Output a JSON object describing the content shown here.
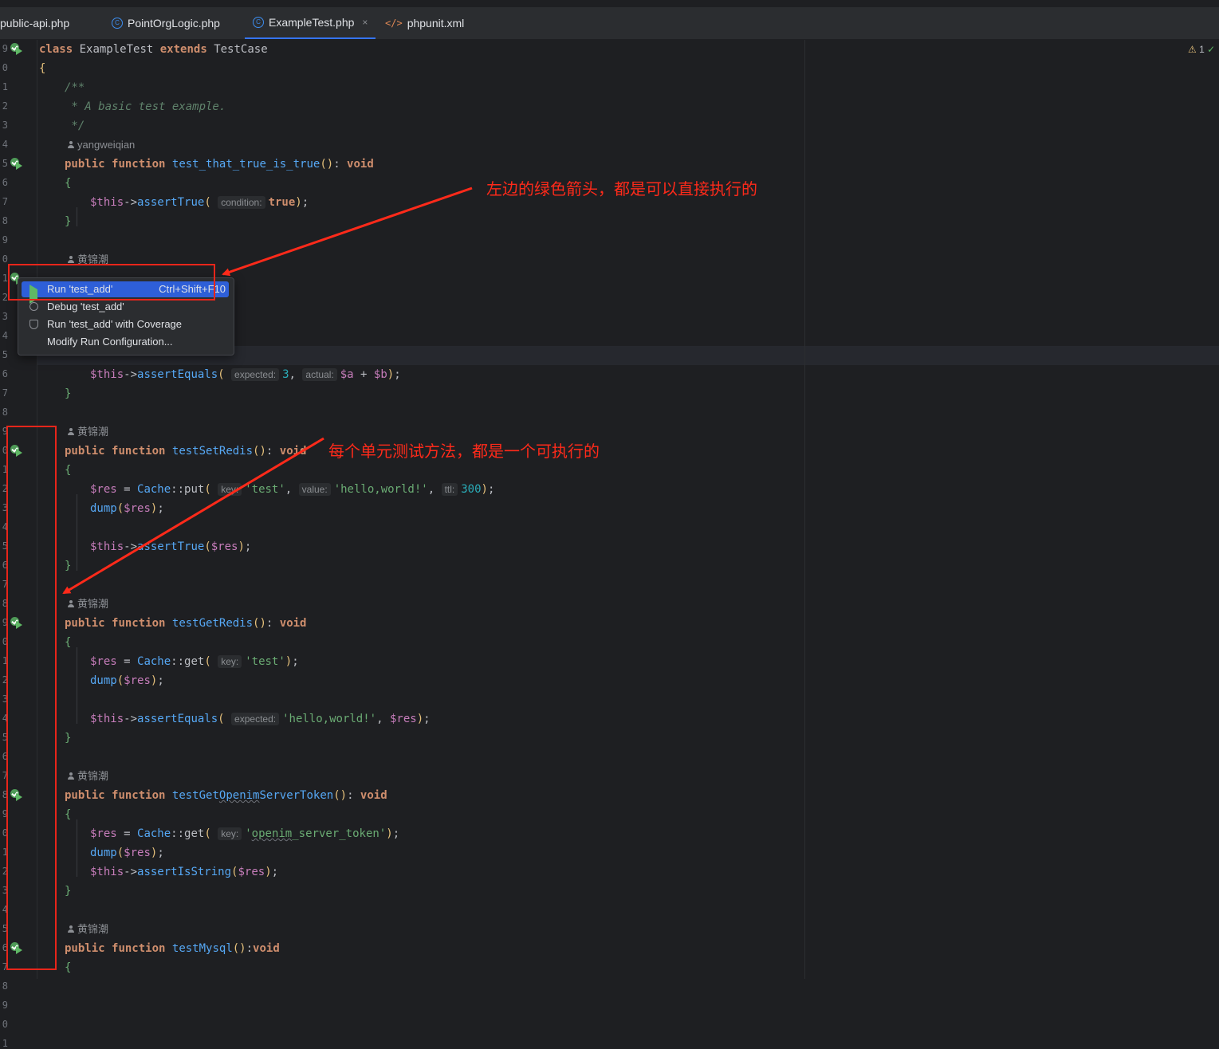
{
  "tabs": [
    {
      "label": "public-api.php",
      "icon": "php-file-icon",
      "active": false
    },
    {
      "label": "PointOrgLogic.php",
      "icon": "php-class-icon",
      "active": false
    },
    {
      "label": "ExampleTest.php",
      "icon": "php-test-class-icon",
      "active": true
    },
    {
      "label": "phpunit.xml",
      "icon": "xml-file-icon",
      "active": false
    }
  ],
  "tab_close_glyph": "×",
  "inspection": {
    "warnings": "1",
    "warn_glyph": "⚠",
    "ok_glyph": "✓"
  },
  "line_numbers": [
    "9",
    "0",
    "1",
    "2",
    "3",
    "4",
    "5",
    "6",
    "7",
    "8",
    "9",
    "0",
    "1",
    "2",
    "3",
    "4",
    "5",
    "6",
    "7",
    "8",
    "9",
    "0",
    "1",
    "2",
    "3",
    "4",
    "5",
    "6",
    "7",
    "8",
    "9",
    "0",
    "1",
    "2",
    "3",
    "4",
    "5",
    "6",
    "7",
    "8",
    "9",
    "0",
    "1",
    "2",
    "3",
    "4",
    "5",
    "6",
    "7",
    "8",
    "9",
    "0",
    "1"
  ],
  "authors": {
    "a1": "yangweiqian",
    "a2": "黄锦潮",
    "a3": "黄锦潮",
    "a4": "黄锦潮",
    "a5": "黄锦潮",
    "a6": "黄锦潮"
  },
  "code": {
    "class_kw": "class",
    "class_name": "ExampleTest",
    "extends_kw": "extends",
    "parent_class": "TestCase",
    "open_brace": "{",
    "close_brace": "}",
    "doc_open": "/**",
    "doc_line": " * A basic test example.",
    "doc_close": " */",
    "public_kw": "public",
    "function_kw": "function",
    "void_kw": "void",
    "fn1": "test_that_true_is_true",
    "fn3": "testSetRedis",
    "fn4": "testGetRedis",
    "fn5_a": "testGet",
    "fn5_b": "Openim",
    "fn5_c": "ServerToken",
    "fn6": "testMysql",
    "this": "$this",
    "arrow": "->",
    "assertTrue": "assertTrue",
    "assertEquals": "assertEquals",
    "assertIsString": "assertIsString",
    "hint_condition": "condition:",
    "hint_expected": "expected:",
    "hint_actual": "actual:",
    "hint_key": "key:",
    "hint_value": "value:",
    "hint_ttl": "ttl:",
    "true_kw": "true",
    "num_3": "3",
    "num_300": "300",
    "var_a": "$a",
    "var_b": "$b",
    "var_res": "$res",
    "cache": "Cache",
    "put": "put",
    "get": "get",
    "dump": "dump",
    "str_test": "'test'",
    "str_hello": "'hello,world!'",
    "str_openim_a": "'",
    "str_openim_b": "openim",
    "str_openim_c": "_server_token'"
  },
  "popup": {
    "items": [
      {
        "label": "Run 'test_add'",
        "shortcut": "Ctrl+Shift+F10",
        "icon": "run-play-icon"
      },
      {
        "label": "Debug 'test_add'",
        "icon": "debug-bug-icon"
      },
      {
        "label": "Run 'test_add' with Coverage",
        "icon": "coverage-shield-icon"
      },
      {
        "label": "Modify Run Configuration..."
      }
    ]
  },
  "annotations": {
    "top": "左边的绿色箭头，都是可以直接执行的",
    "middle": "每个单元测试方法，都是一个可执行的"
  },
  "colors": {
    "accent": "#3574f0",
    "run_green": "#5fb865",
    "annotation_red": "#e8251a"
  }
}
